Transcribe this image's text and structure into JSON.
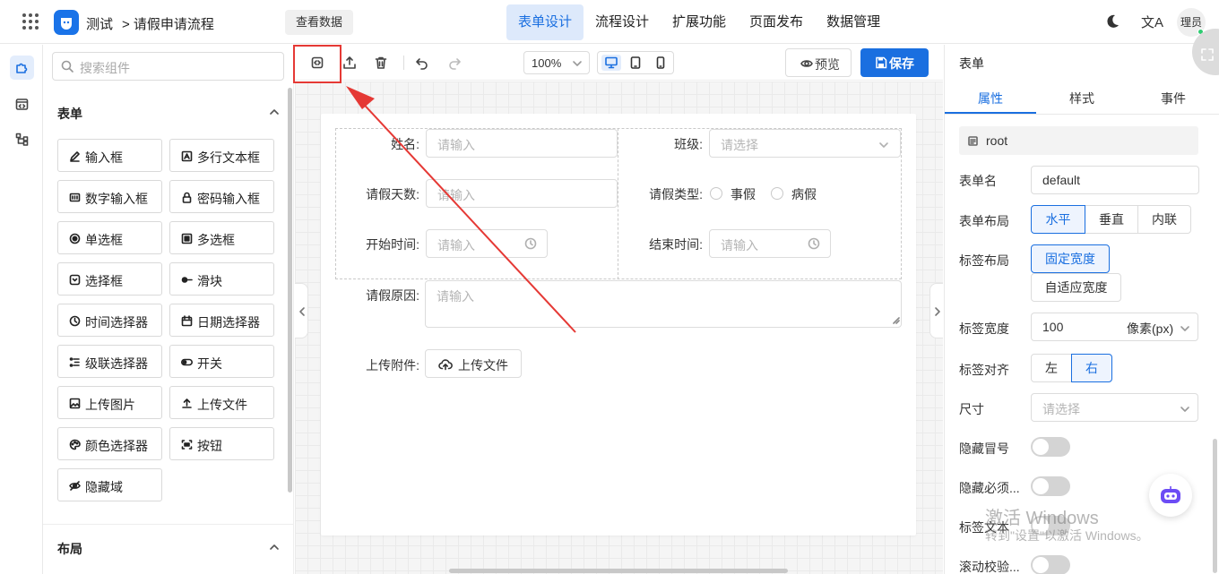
{
  "header": {
    "app_name": "测试",
    "breadcrumb": "> 请假申请流程",
    "view_data_label": "查看数据",
    "tabs": [
      "表单设计",
      "流程设计",
      "扩展功能",
      "页面发布",
      "数据管理"
    ],
    "active_tab": "表单设计",
    "lang_icon": "文A",
    "user_label": "理员"
  },
  "components": {
    "search_placeholder": "搜索组件",
    "form_section": "表单",
    "items": [
      "输入框",
      "多行文本框",
      "数字输入框",
      "密码输入框",
      "单选框",
      "多选框",
      "选择框",
      "滑块",
      "时间选择器",
      "日期选择器",
      "级联选择器",
      "开关",
      "上传图片",
      "上传文件",
      "颜色选择器",
      "按钮",
      "隐藏域"
    ],
    "layout_section": "布局"
  },
  "toolbar": {
    "zoom": "100%",
    "preview_label": "预览",
    "save_label": "保存",
    "accent_color": "#1a6fe0",
    "highlight_color": "#e53935"
  },
  "form": {
    "name_label": "姓名:",
    "class_label": "班级:",
    "days_label": "请假天数:",
    "type_label": "请假类型:",
    "start_label": "开始时间:",
    "end_label": "结束时间:",
    "reason_label": "请假原因:",
    "attach_label": "上传附件:",
    "input_placeholder": "请输入",
    "select_placeholder": "请选择",
    "leave_types": [
      "事假",
      "病假"
    ],
    "upload_label": "上传文件"
  },
  "props": {
    "panel_title": "表单",
    "tabs": [
      "属性",
      "样式",
      "事件"
    ],
    "active_tab": "属性",
    "root_label": "root",
    "form_name_label": "表单名",
    "form_name_value": "default",
    "form_layout_label": "表单布局",
    "form_layout_options": [
      "水平",
      "垂直",
      "内联"
    ],
    "label_layout_label": "标签布局",
    "label_layout_fixed": "固定宽度",
    "label_layout_auto": "自适应宽度",
    "label_width_label": "标签宽度",
    "label_width_value": "100",
    "label_width_unit": "像素(px)",
    "label_align_label": "标签对齐",
    "label_align_options": [
      "左",
      "右"
    ],
    "size_label": "尺寸",
    "size_placeholder": "请选择",
    "hide_colon_label": "隐藏冒号",
    "hide_required_label": "隐藏必须...",
    "label_text_label": "标签文本",
    "scroll_validate_label": "滚动校验..."
  },
  "overlay": {
    "watermark": "激活 Windows",
    "watermark_sub": "转到\"设置\"以激活 Windows。"
  }
}
